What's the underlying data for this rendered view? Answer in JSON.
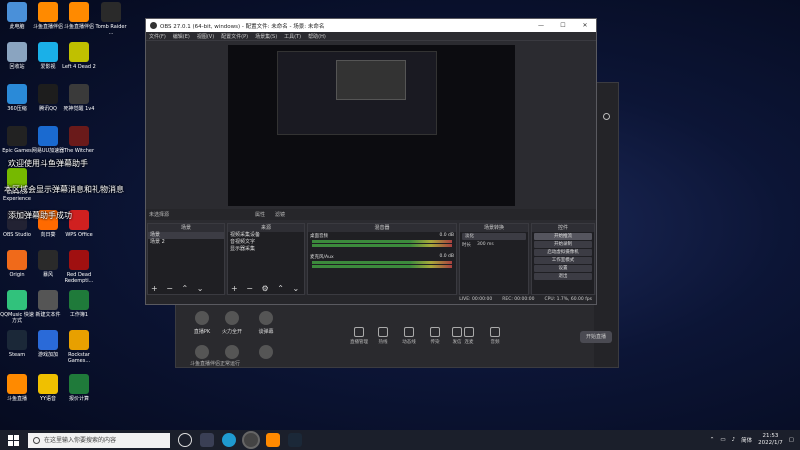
{
  "desktop": {
    "icons": [
      {
        "label": "此电脑",
        "color": "#4a90d9"
      },
      {
        "label": "斗鱼直播伴侣",
        "color": "#ff8a00"
      },
      {
        "label": "斗鱼直播伴侣",
        "color": "#ff8a00"
      },
      {
        "label": "Tomb Raider ...",
        "color": "#2a2a2a"
      },
      {
        "label": "回收站",
        "color": "#8aa4c0"
      },
      {
        "label": "爱影视",
        "color": "#1ab0e8"
      },
      {
        "label": "Left 4 Dead 2",
        "color": "#c0c000"
      },
      {
        "label": "360压缩",
        "color": "#2a8ad8"
      },
      {
        "label": "腾讯QQ",
        "color": "#1d1d1d"
      },
      {
        "label": "死神觉醒 1v4",
        "color": "#3a3a3a"
      },
      {
        "label": "Epic Games",
        "color": "#222222"
      },
      {
        "label": "网易UU加速器",
        "color": "#1a6ad0"
      },
      {
        "label": "The Witcher",
        "color": "#6a1a1a"
      },
      {
        "label": "GeForce Experience",
        "color": "#76b900"
      },
      {
        "label": "OBS Studio",
        "color": "#222233"
      },
      {
        "label": "向日葵",
        "color": "#ff6a00"
      },
      {
        "label": "WPS Office",
        "color": "#d02020"
      },
      {
        "label": "Origin",
        "color": "#f06a1a"
      },
      {
        "label": "暴风",
        "color": "#2a2a2a"
      },
      {
        "label": "Red Dead Redempti...",
        "color": "#a01010"
      },
      {
        "label": "QQMusic 快速方式",
        "color": "#31c27c"
      },
      {
        "label": "新建文本件",
        "color": "#555555"
      },
      {
        "label": "工作簿1",
        "color": "#1f7a3a"
      },
      {
        "label": "Steam",
        "color": "#1b2838"
      },
      {
        "label": "游戏加加",
        "color": "#2a6ad8"
      },
      {
        "label": "Rockstar Games...",
        "color": "#e8a000"
      },
      {
        "label": "斗鱼直播",
        "color": "#ff8a00"
      },
      {
        "label": "YY语音",
        "color": "#f0c000"
      },
      {
        "label": "报价计算",
        "color": "#1f7a3a"
      }
    ]
  },
  "overlays": {
    "line1": "欢迎使用斗鱼弹幕助手",
    "line2": "本区域会显示弹幕消息和礼物消息",
    "line3": "添加弹幕助手成功"
  },
  "obs": {
    "title": "OBS 27.0.1 (64-bit, windows) - 配置文件: 未命名 - 场景: 未命名",
    "min": "—",
    "max": "☐",
    "close": "✕",
    "menu": [
      "文件(F)",
      "编辑(E)",
      "视图(V)",
      "配置文件(P)",
      "场景集(S)",
      "工具(T)",
      "帮助(H)"
    ],
    "scene_label": "未选择源",
    "scene_attrs": [
      "属性",
      "滤镜"
    ],
    "docks": {
      "scenes": {
        "title": "场景",
        "items": [
          "场景",
          "场景 2"
        ]
      },
      "sources": {
        "title": "来源",
        "items": [
          "视频采集设备",
          "音视频文字",
          "显示器采集"
        ]
      },
      "mixer": {
        "title": "混音器",
        "channels": [
          {
            "name": "桌面音频",
            "level": "0.0 dB"
          },
          {
            "name": "麦克风/Aux",
            "level": "0.0 dB"
          }
        ]
      },
      "transitions": {
        "title": "场景转换",
        "type": "淡化",
        "duration_label": "时长",
        "duration": "300 ms"
      },
      "controls": {
        "title": "控件",
        "buttons": [
          "开始推流",
          "开始录制",
          "启动虚拟摄像机",
          "工作室模式",
          "设置",
          "退出"
        ]
      }
    },
    "status": {
      "live": "LIVE: 00:00:00",
      "rec": "REC: 00:00:00",
      "cpu": "CPU: 1.7%, 60.00 fps"
    }
  },
  "bg_app": {
    "tiles": [
      "直播PK",
      "火力全开",
      "谈弹幕",
      "",
      ""
    ],
    "footer": "斗鱼直播伴侣正常运行",
    "tools": [
      "直播管理",
      "热线",
      "动态线",
      "传染",
      "发信",
      "连麦",
      "音频"
    ],
    "start_btn": "开始直播"
  },
  "taskbar": {
    "search_placeholder": "在这里输入你要搜索的内容",
    "ime": "简体",
    "time": "21:53",
    "date": "2022/1/7"
  }
}
